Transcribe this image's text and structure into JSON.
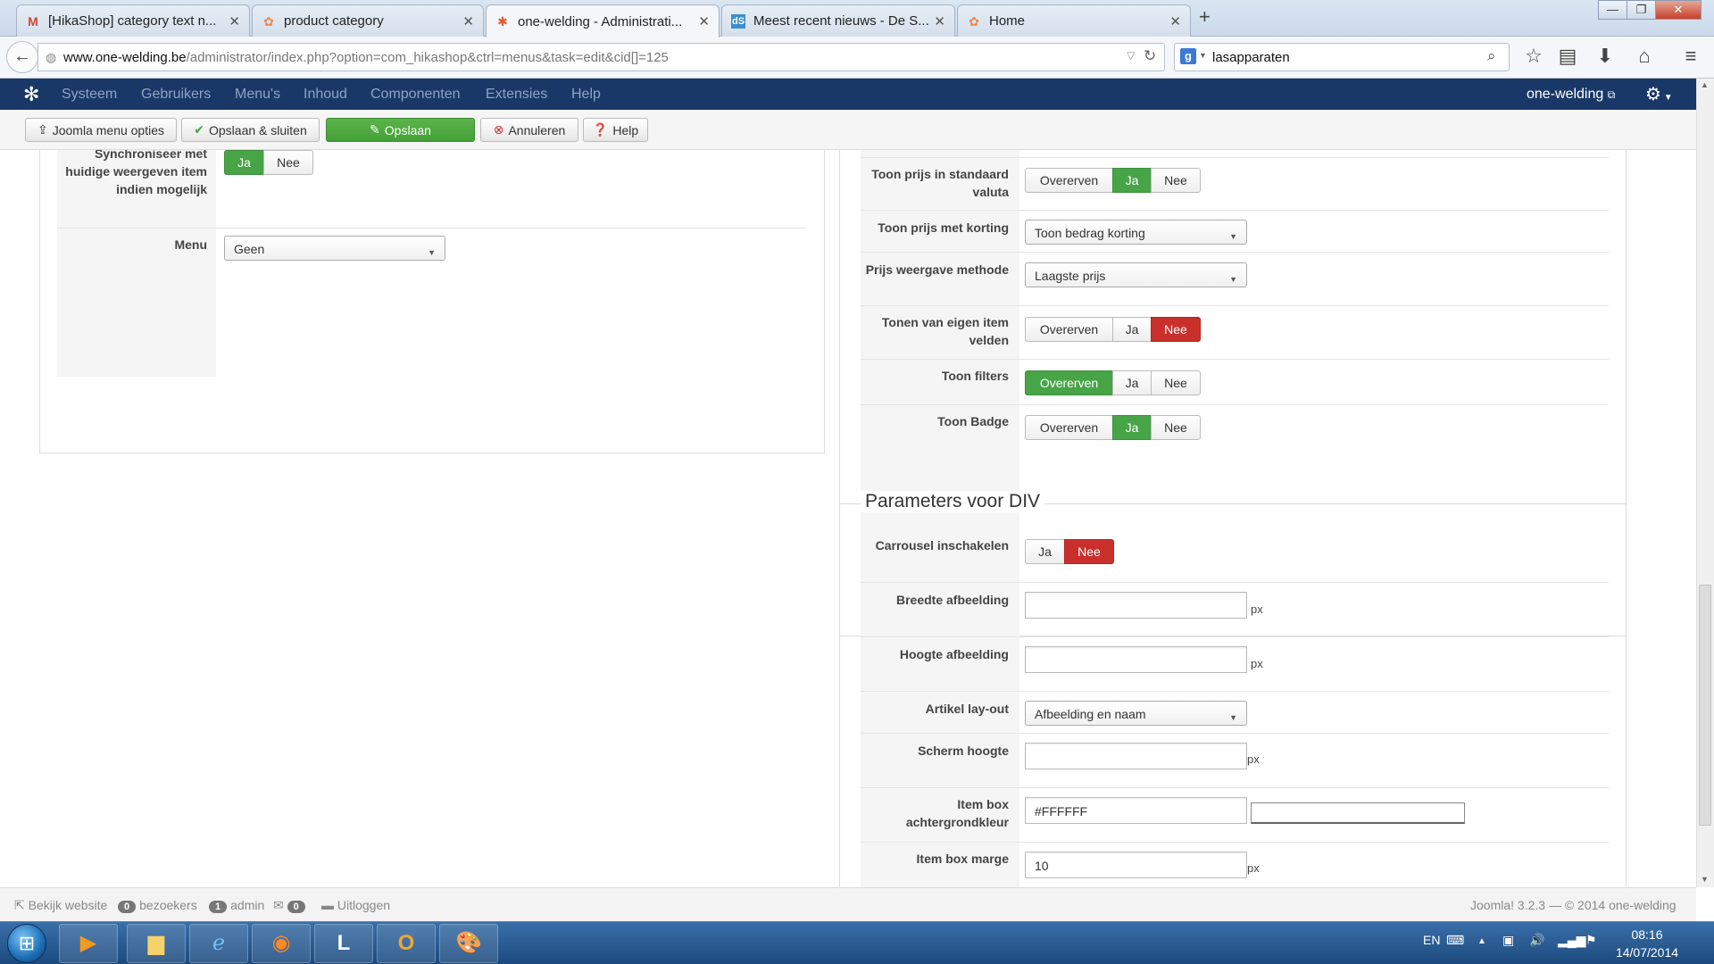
{
  "browser": {
    "tabs": [
      {
        "label": "[HikaShop] category text n...",
        "icon": "gmail-icon"
      },
      {
        "label": "product category",
        "icon": "hikashop-icon"
      },
      {
        "label": "one-welding - Administrati...",
        "icon": "joomla-icon"
      },
      {
        "label": "Meest recent nieuws - De S...",
        "icon": "ds-icon"
      },
      {
        "label": "Home",
        "icon": "hikashop-icon"
      }
    ],
    "url_host": "www.one-welding.be",
    "url_path": "/administrator/index.php?option=com_hikashop&ctrl=menus&task=edit&cid[]=125",
    "search_value": "lasapparaten"
  },
  "joomla": {
    "menu": [
      "Systeem",
      "Gebruikers",
      "Menu's",
      "Inhoud",
      "Componenten",
      "Extensies",
      "Help"
    ],
    "site_name": "one-welding"
  },
  "toolbar": {
    "menu_options": "Joomla menu opties",
    "save_close": "Opslaan & sluiten",
    "save": "Opslaan",
    "cancel": "Annuleren",
    "help": "Help"
  },
  "left_panel": {
    "sync_label": "Synchroniseer met huidige weergeven item indien mogelijk",
    "sync_options": [
      "Ja",
      "Nee"
    ],
    "menu_label": "Menu",
    "menu_value": "Geen"
  },
  "right_panel": {
    "rows": [
      {
        "label": "Toon prijs in standaard valuta",
        "type": "toggle",
        "options": [
          "Overerven",
          "Ja",
          "Nee"
        ],
        "selected": "Ja",
        "selected_color": "green"
      },
      {
        "label": "Toon prijs met korting",
        "type": "select",
        "value": "Toon bedrag korting"
      },
      {
        "label": "Prijs weergave methode",
        "type": "select",
        "value": "Laagste prijs"
      },
      {
        "label": "Tonen van eigen item velden",
        "type": "toggle",
        "options": [
          "Overerven",
          "Ja",
          "Nee"
        ],
        "selected": "Nee",
        "selected_color": "red"
      },
      {
        "label": "Toon filters",
        "type": "toggle",
        "options": [
          "Overerven",
          "Ja",
          "Nee"
        ],
        "selected": "Overerven",
        "selected_color": "green"
      },
      {
        "label": "Toon Badge",
        "type": "toggle",
        "options": [
          "Overerven",
          "Ja",
          "Nee"
        ],
        "selected": "Ja",
        "selected_color": "green"
      }
    ]
  },
  "div_panel": {
    "legend": "Parameters voor DIV",
    "carrousel_label": "Carrousel inschakelen",
    "carrousel_options": [
      "Ja",
      "Nee"
    ],
    "breedte_label": "Breedte afbeelding",
    "breedte_value": "",
    "hoogte_label": "Hoogte afbeelding",
    "hoogte_value": "",
    "artikel_label": "Artikel lay-out",
    "artikel_value": "Afbeelding en naam",
    "scherm_label": "Scherm hoogte",
    "scherm_value": "",
    "bgcolor_label": "Item box achtergrondkleur",
    "bgcolor_value": "#FFFFFF",
    "marge_label": "Item box marge",
    "marge_value": "10",
    "unit": "px"
  },
  "footer": {
    "view_site": "Bekijk website",
    "visitors_count": "0",
    "visitors_label": "bezoekers",
    "admin_count": "1",
    "admin_label": "admin",
    "messages_count": "0",
    "logout": "Uitloggen",
    "version": "Joomla! 3.2.3 — © 2014 one-welding"
  },
  "taskbar": {
    "lang": "EN",
    "time": "08:16",
    "date": "14/07/2014"
  },
  "colors": {
    "joomla_nav": "#1a3867",
    "green": "#47a447",
    "red": "#c9302c"
  }
}
